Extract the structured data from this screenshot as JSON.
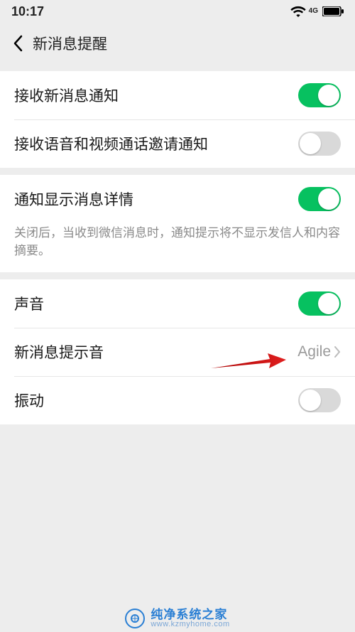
{
  "status": {
    "time": "10:17",
    "network_label": "4G"
  },
  "nav": {
    "title": "新消息提醒"
  },
  "rows": {
    "receive_msg": {
      "label": "接收新消息通知"
    },
    "receive_av": {
      "label": "接收语音和视频通话邀请通知"
    },
    "show_detail": {
      "label": "通知显示消息详情",
      "desc": "关闭后，当收到微信消息时，通知提示将不显示发信人和内容摘要。"
    },
    "sound": {
      "label": "声音"
    },
    "msg_tone": {
      "label": "新消息提示音",
      "value": "Agile"
    },
    "vibrate": {
      "label": "振动"
    }
  },
  "watermark": {
    "main": "纯净系统之家",
    "sub": "www.kzmyhome.com"
  }
}
